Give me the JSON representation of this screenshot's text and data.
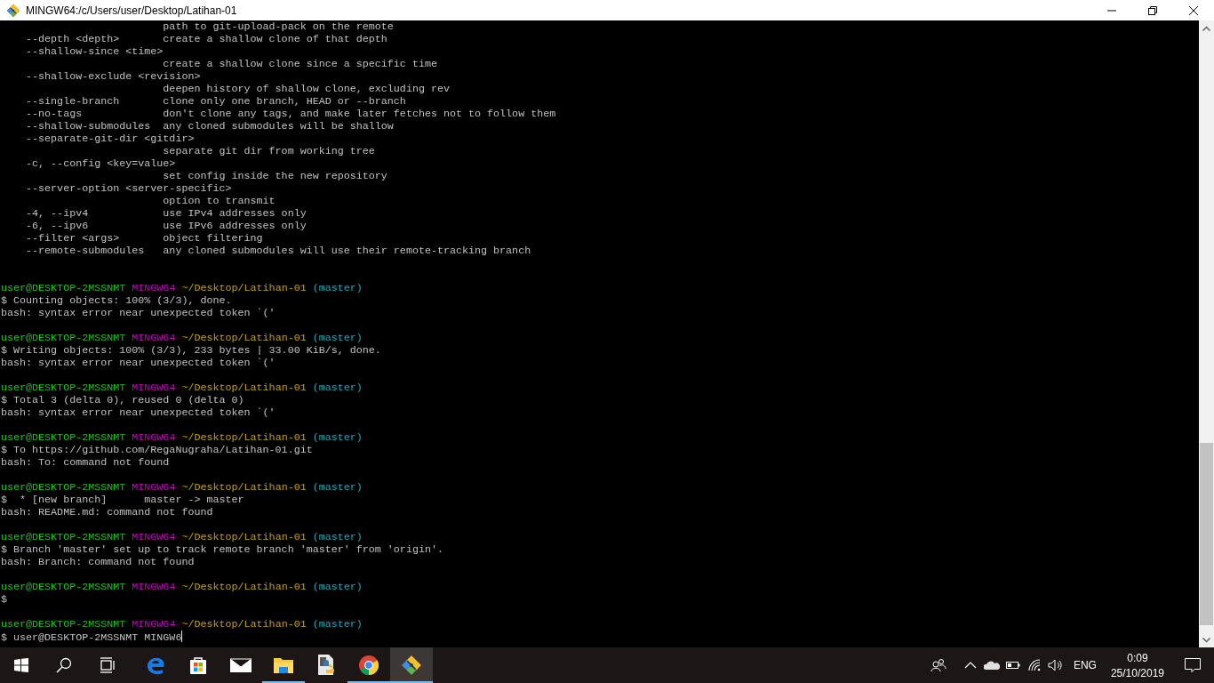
{
  "window": {
    "title": "MINGW64:/c/Users/user/Desktop/Latihan-01"
  },
  "terminal": {
    "help_lines": [
      "                          path to git-upload-pack on the remote",
      "    --depth <depth>       create a shallow clone of that depth",
      "    --shallow-since <time>",
      "                          create a shallow clone since a specific time",
      "    --shallow-exclude <revision>",
      "                          deepen history of shallow clone, excluding rev",
      "    --single-branch       clone only one branch, HEAD or --branch",
      "    --no-tags             don't clone any tags, and make later fetches not to follow them",
      "    --shallow-submodules  any cloned submodules will be shallow",
      "    --separate-git-dir <gitdir>",
      "                          separate git dir from working tree",
      "    -c, --config <key=value>",
      "                          set config inside the new repository",
      "    --server-option <server-specific>",
      "                          option to transmit",
      "    -4, --ipv4            use IPv4 addresses only",
      "    -6, --ipv6            use IPv6 addresses only",
      "    --filter <args>       object filtering",
      "    --remote-submodules   any cloned submodules will use their remote-tracking branch"
    ],
    "sessions": [
      {
        "prompt": {
          "user": "user@DESKTOP-2MSSNMT",
          "system": "MINGW64",
          "path": "~/Desktop/Latihan-01",
          "branch": "(master)"
        },
        "input": "$ Counting objects: 100% (3/3), done.",
        "output": "bash: syntax error near unexpected token `('"
      },
      {
        "prompt": {
          "user": "user@DESKTOP-2MSSNMT",
          "system": "MINGW64",
          "path": "~/Desktop/Latihan-01",
          "branch": "(master)"
        },
        "input": "$ Writing objects: 100% (3/3), 233 bytes | 33.00 KiB/s, done.",
        "output": "bash: syntax error near unexpected token `('"
      },
      {
        "prompt": {
          "user": "user@DESKTOP-2MSSNMT",
          "system": "MINGW64",
          "path": "~/Desktop/Latihan-01",
          "branch": "(master)"
        },
        "input": "$ Total 3 (delta 0), reused 0 (delta 0)",
        "output": "bash: syntax error near unexpected token `('"
      },
      {
        "prompt": {
          "user": "user@DESKTOP-2MSSNMT",
          "system": "MINGW64",
          "path": "~/Desktop/Latihan-01",
          "branch": "(master)"
        },
        "input": "$ To https://github.com/RegaNugraha/Latihan-01.git",
        "output": "bash: To: command not found"
      },
      {
        "prompt": {
          "user": "user@DESKTOP-2MSSNMT",
          "system": "MINGW64",
          "path": "~/Desktop/Latihan-01",
          "branch": "(master)"
        },
        "input": "$  * [new branch]      master -> master",
        "output": "bash: README.md: command not found"
      },
      {
        "prompt": {
          "user": "user@DESKTOP-2MSSNMT",
          "system": "MINGW64",
          "path": "~/Desktop/Latihan-01",
          "branch": "(master)"
        },
        "input": "$ Branch 'master' set up to track remote branch 'master' from 'origin'.",
        "output": "bash: Branch: command not found"
      },
      {
        "prompt": {
          "user": "user@DESKTOP-2MSSNMT",
          "system": "MINGW64",
          "path": "~/Desktop/Latihan-01",
          "branch": "(master)"
        },
        "input": "$"
      },
      {
        "prompt": {
          "user": "user@DESKTOP-2MSSNMT",
          "system": "MINGW64",
          "path": "~/Desktop/Latihan-01",
          "branch": "(master)"
        },
        "input": "$ user@DESKTOP-2MSSNMT MINGW6",
        "cursor": true
      }
    ]
  },
  "taskbar": {
    "apps": [
      {
        "kind": "edge",
        "running": false,
        "active": false
      },
      {
        "kind": "store",
        "running": false,
        "active": false
      },
      {
        "kind": "mail",
        "running": false,
        "active": false
      },
      {
        "kind": "explorer",
        "running": true,
        "active": false
      },
      {
        "kind": "python",
        "running": false,
        "active": false
      },
      {
        "kind": "chrome",
        "running": true,
        "active": false
      },
      {
        "kind": "git",
        "running": true,
        "active": true
      }
    ],
    "language": "ENG",
    "time": "0:09",
    "date": "25/10/2019"
  }
}
